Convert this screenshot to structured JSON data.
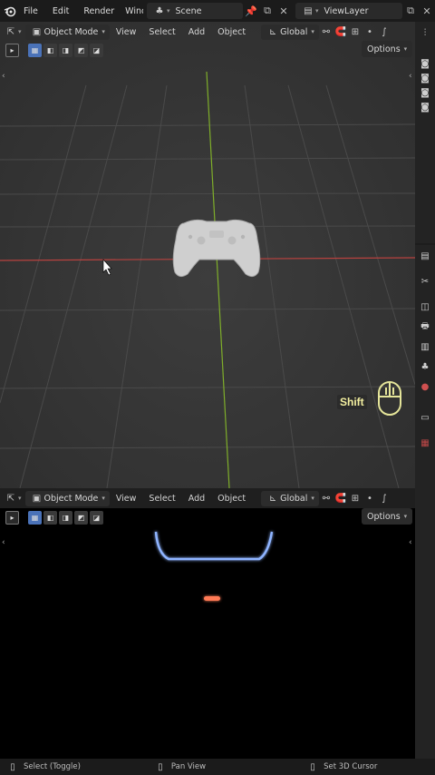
{
  "topbar": {
    "menus": [
      "File",
      "Edit",
      "Render",
      "Windov"
    ],
    "scene": "Scene",
    "view_layer": "ViewLayer"
  },
  "viewport_top": {
    "mode": "Object Mode",
    "menus": [
      "View",
      "Select",
      "Add",
      "Object"
    ],
    "orientation": "Global",
    "options": "Options"
  },
  "viewport_bottom": {
    "mode": "Object Mode",
    "menus": [
      "View",
      "Select",
      "Add",
      "Object"
    ],
    "orientation": "Global",
    "options": "Options"
  },
  "overlay": {
    "shift_key": "Shift"
  },
  "statusbar": {
    "left": "Select (Toggle)",
    "middle": "Pan View",
    "right": "Set 3D Cursor"
  },
  "colors": {
    "x_axis": "#b8423f",
    "y_axis": "#7fae2a",
    "accent": "#4a72b8",
    "glow_blue": "#8fb4ff",
    "glow_orange": "#ff7a55"
  }
}
